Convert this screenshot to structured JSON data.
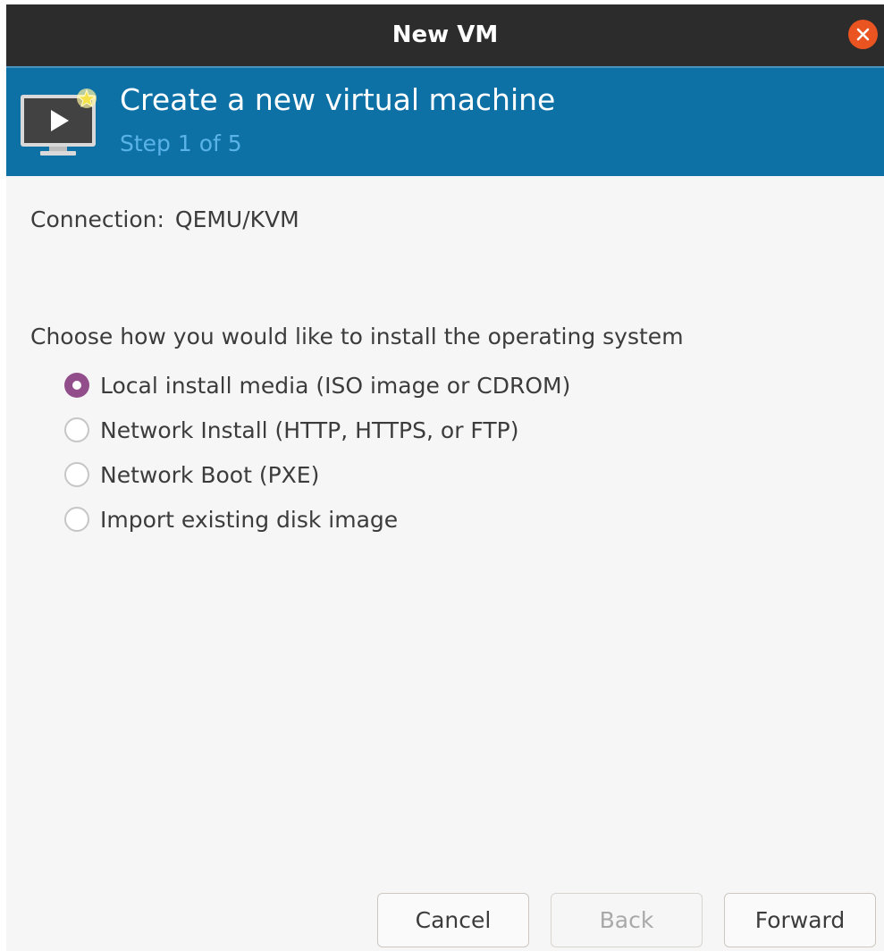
{
  "window": {
    "title": "New VM"
  },
  "header": {
    "title": "Create a new virtual machine",
    "step": "Step 1 of 5",
    "icon": "vm-monitor-icon"
  },
  "connection": {
    "label": "Connection:",
    "value": "QEMU/KVM"
  },
  "install": {
    "prompt": "Choose how you would like to install the operating system",
    "options": [
      {
        "label": "Local install media (ISO image or CDROM)",
        "selected": true
      },
      {
        "label": "Network Install (HTTP, HTTPS, or FTP)",
        "selected": false
      },
      {
        "label": "Network Boot (PXE)",
        "selected": false
      },
      {
        "label": "Import existing disk image",
        "selected": false
      }
    ]
  },
  "buttons": {
    "cancel": "Cancel",
    "back": "Back",
    "forward": "Forward"
  },
  "colors": {
    "header_bg": "#0e71a6",
    "titlebar_bg": "#2c2c2c",
    "close_button": "#e95420",
    "radio_selected": "#924d8b"
  }
}
